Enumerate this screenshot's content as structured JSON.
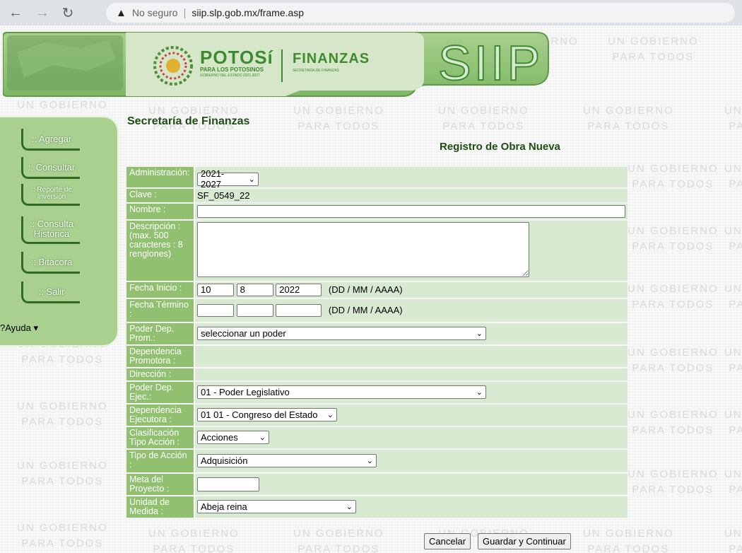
{
  "browser": {
    "security_label": "No seguro",
    "separator": "|",
    "url": "siip.slp.gob.mx/frame.asp"
  },
  "watermark": {
    "line1": "UN GOBIERNO",
    "line2": "PARA TODOS"
  },
  "header": {
    "brand_name": "POTOSí",
    "brand_sub": "PARA LOS POTOSINOS",
    "brand_sub2": "GOBIERNO DEL ESTADO 2021-2027",
    "dept_name": "FINANZAS",
    "dept_sub": "SECRETARÍA DE FINANZAS",
    "system": "SIIP"
  },
  "sidebar": {
    "items": [
      {
        "label": ":: Agregar"
      },
      {
        "label": ":: Consultar"
      },
      {
        "label": ":: Reporte de Inversión"
      },
      {
        "label": ":: Consulta Histórica"
      },
      {
        "label": ":: Bitácora"
      },
      {
        "label": ":: Salir"
      }
    ],
    "help": "?Ayuda ▾"
  },
  "page": {
    "title": "Secretaría de Finanzas",
    "subtitle": "Registro de Obra Nueva"
  },
  "form": {
    "administracion": {
      "label": "Administración:",
      "value": "2021-2027"
    },
    "clave": {
      "label": "Clave :",
      "value": "SF_0549_22"
    },
    "nombre": {
      "label": "Nombre :",
      "value": ""
    },
    "descripcion": {
      "label": "Descripción : (max. 500 caracteres : 8 renglones)",
      "value": ""
    },
    "fecha_inicio": {
      "label": "Fecha Inicio :",
      "dd": "10",
      "mm": "8",
      "aaaa": "2022",
      "hint": "(DD / MM / AAAA)"
    },
    "fecha_termino": {
      "label": "Fecha Término :",
      "dd": "",
      "mm": "",
      "aaaa": "",
      "hint": "(DD / MM / AAAA)"
    },
    "poder_dep_prom": {
      "label": "Poder Dep. Prom.:",
      "value": "seleccionar un poder"
    },
    "dependencia_promotora": {
      "label": "Dependencia Promotora :",
      "value": ""
    },
    "direccion": {
      "label": "Dirección :",
      "value": ""
    },
    "poder_dep_ejec": {
      "label": "Poder Dep. Ejec.:",
      "value": "01 - Poder Legislativo"
    },
    "dependencia_ejecutora": {
      "label": "Dependencia Ejecutora :",
      "value": "01 01 - Congreso del Estado"
    },
    "clasificacion_tipo_accion": {
      "label": "Clasificación Tipo Acción :",
      "value": "Acciones"
    },
    "tipo_de_accion": {
      "label": "Tipo de Acción :",
      "value": "Adquisición"
    },
    "meta_del_proyecto": {
      "label": "Meta del Proyecto :",
      "value": ""
    },
    "unidad_de_medida": {
      "label": "Unidad de Medida :",
      "value": "Abeja reina"
    }
  },
  "buttons": {
    "cancel": "Cancelar",
    "save": "Guardar y Continuar"
  },
  "colors": {
    "label_bg": "#90c070",
    "value_bg": "#d9ead3",
    "sidebar_bg": "#a9d08e",
    "title": "#1e4d14"
  }
}
